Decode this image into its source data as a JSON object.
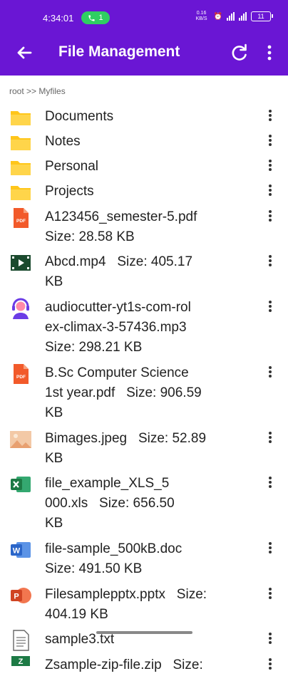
{
  "status": {
    "time": "4:34:01",
    "call_count": "1",
    "net_speed_top": "0.16",
    "net_speed_bottom": "KB/S",
    "battery": "11"
  },
  "appbar": {
    "title": "File Management"
  },
  "breadcrumb": "root >> Myfiles",
  "files": [
    {
      "lines": [
        "Documents"
      ],
      "icon": "folder-icon"
    },
    {
      "lines": [
        "Notes"
      ],
      "icon": "folder-icon"
    },
    {
      "lines": [
        "Personal"
      ],
      "icon": "folder-icon"
    },
    {
      "lines": [
        "Projects"
      ],
      "icon": "folder-icon"
    },
    {
      "lines": [
        "A123456_semester-5.pdf",
        "Size: 28.58 KB"
      ],
      "icon": "pdf-icon"
    },
    {
      "lines": [
        "Abcd.mp4   Size: 405.17",
        "KB"
      ],
      "icon": "video-icon"
    },
    {
      "lines": [
        "audiocutter-yt1s-com-rol",
        "ex-climax-3-57436.mp3",
        "Size: 298.21 KB"
      ],
      "icon": "audio-icon"
    },
    {
      "lines": [
        "B.Sc Computer Science",
        "1st year.pdf   Size: 906.59",
        "KB"
      ],
      "icon": "pdf-icon"
    },
    {
      "lines": [
        "Bimages.jpeg   Size: 52.89",
        "KB"
      ],
      "icon": "image-icon"
    },
    {
      "lines": [
        "file_example_XLS_5",
        "000.xls   Size: 656.50",
        "KB"
      ],
      "icon": "excel-icon"
    },
    {
      "lines": [
        "file-sample_500kB.doc",
        "Size: 491.50 KB"
      ],
      "icon": "word-icon"
    },
    {
      "lines": [
        "Filesamplepptx.pptx   Size:",
        "404.19 KB"
      ],
      "icon": "powerpoint-icon"
    },
    {
      "lines": [
        "sample3.txt"
      ],
      "icon": "text-file-icon"
    },
    {
      "lines": [
        "Zsample-zip-file.zip   Size:"
      ],
      "icon": "zip-icon"
    }
  ],
  "colors": {
    "accent": "#6a16d4",
    "folder": "#ffc61a",
    "pdf": "#f25a2a",
    "excel": "#1d7a45",
    "word": "#2b66c9",
    "powerpoint": "#d04423"
  }
}
